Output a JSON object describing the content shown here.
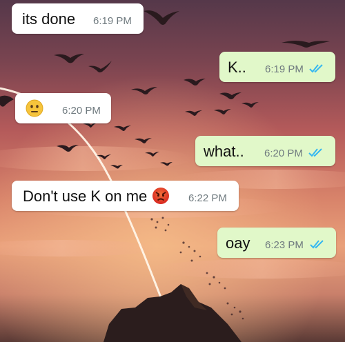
{
  "colors": {
    "incoming_bubble": "#ffffff",
    "outgoing_bubble": "#e1f8c9",
    "read_ticks": "#34b7f1",
    "timestamp": "#6f7a7f"
  },
  "messages": [
    {
      "direction": "incoming",
      "text": "its done",
      "time": "6:19 PM"
    },
    {
      "direction": "outgoing",
      "text": "K..",
      "time": "6:19 PM",
      "status": "read-double-tick"
    },
    {
      "direction": "incoming",
      "text": "",
      "emoji": "neutral-face-icon",
      "time": "6:20 PM"
    },
    {
      "direction": "outgoing",
      "text": "what..",
      "time": "6:20 PM",
      "status": "read-double-tick"
    },
    {
      "direction": "incoming",
      "text": "Don't use K on me",
      "emoji": "angry-face-icon",
      "time": "6:22 PM"
    },
    {
      "direction": "outgoing",
      "text": "oay",
      "time": "6:23 PM",
      "status": "read-double-tick"
    }
  ]
}
